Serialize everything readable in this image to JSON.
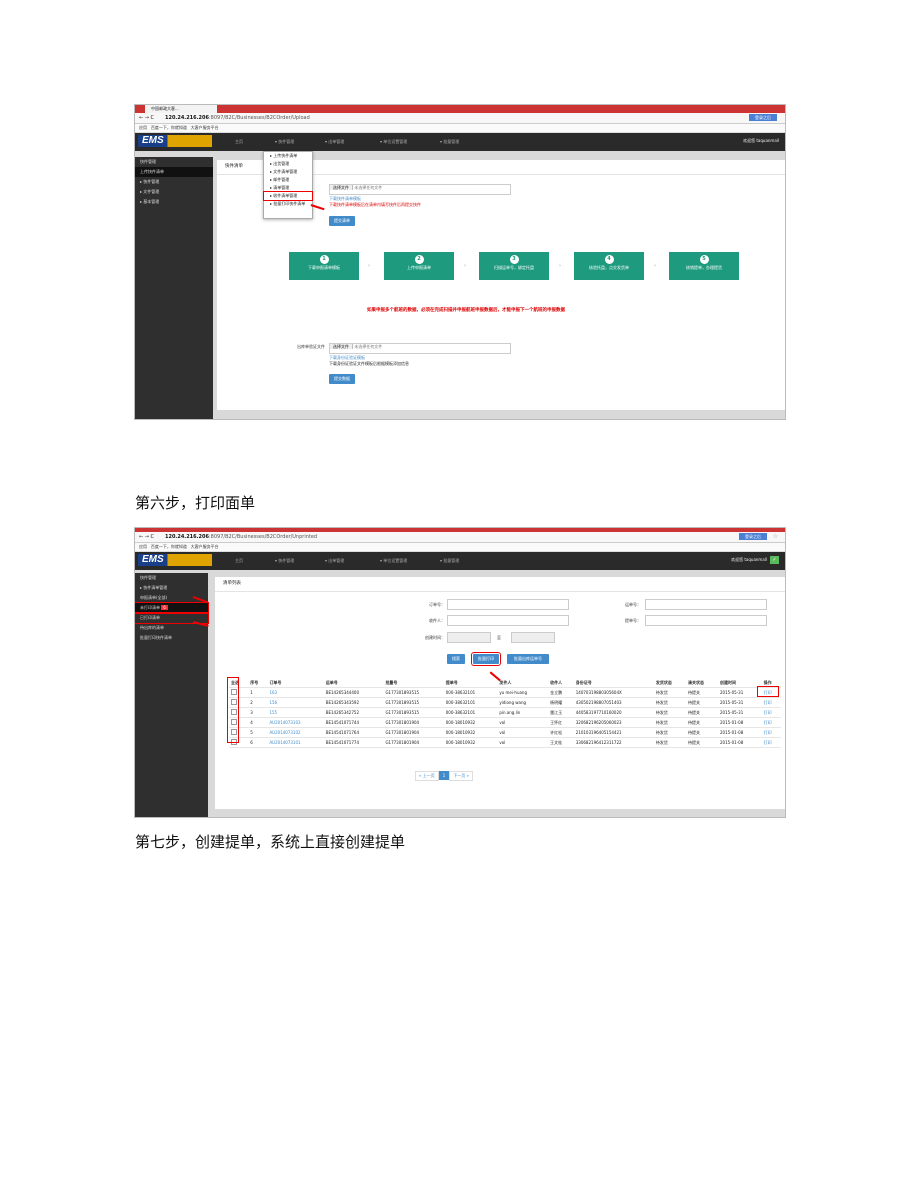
{
  "shot1": {
    "tab_title": "中国邮政大客...",
    "url_host": "120.24.216.206",
    "url_path": ":8097/B2C/Businesses/B2COrder/Upload",
    "bookmarks": [
      "应用",
      "百度一下，你就知道",
      "大客户服务平台"
    ],
    "login_button": "登录之后",
    "logo": "EMS",
    "nav": [
      "主页",
      "▾ 快件管理",
      "▾ 出单管理",
      "▾ 单位设置管理",
      "▾ 批量管理"
    ],
    "user": "欢迎您 taquanmall",
    "sidebar": [
      "快件管理",
      "上传快件清单",
      "▸ 快件管理",
      "▸ 文件管理",
      "▸ 基本管理"
    ],
    "dropdown": [
      "▸ 上传快件清单",
      "▸ 出货管理",
      "▸ 文件清单管理",
      "▸ 邮件管理",
      "▸ 清单管理",
      "▸ 收件清单管理",
      "▸ 批量打印快件清单"
    ],
    "panel_title": "快件清单",
    "choose_file": "选择文件",
    "no_file": "未选择任何文件",
    "template_link": "下载快件清单模板",
    "note1": "下载快件清单模板后在清单内填写快件后再提交快件",
    "submit": "提交清单",
    "steps": [
      {
        "num": "1",
        "label": "下载申报清单模板"
      },
      {
        "num": "2",
        "label": "上传申报清单"
      },
      {
        "num": "3",
        "label": "扫描运单号，绑定托盘"
      },
      {
        "num": "4",
        "label": "核验托盘，点交发货单"
      },
      {
        "num": "5",
        "label": "核销提单，办理提货"
      }
    ],
    "red_note": "如果申报多个航班的数据，必须在完成扫描并申报航班申报数据后，才能申报下一个航班的申报数据",
    "section2_label": "出库单验证文件",
    "section2_link": "下载身份证验证模板",
    "section2_note": "下载身份证验证文件模板后根据模板添加信息",
    "section2_submit": "提交数据"
  },
  "caption1": "第六步，打印面单",
  "shot2": {
    "url_host": "120.24.216.206",
    "url_path": ":8097/B2C/Businesses/B2COrder/Unprinted",
    "bookmarks": [
      "应用",
      "百度一下，你就知道",
      "大客户服务平台"
    ],
    "login_button": "登录之后",
    "logo": "EMS",
    "nav": [
      "主页",
      "▾ 快件管理",
      "▾ 出单管理",
      "▾ 单位设置管理",
      "▾ 批量管理"
    ],
    "user": "欢迎您 taquanmall",
    "sidebar": [
      "快件管理",
      "▸ 快件清单管理",
      "申报清单(全部)",
      "未打印清单",
      "已打印清单",
      "待出库的清单",
      "批量打印快件清单"
    ],
    "unprinted_badge": "6",
    "panel_title": "清单列表",
    "filters": {
      "order_no": "订单号：",
      "waybill_no": "运单号：",
      "recipient": "收件人：",
      "bill_no": "提单号：",
      "created": "创建时间：",
      "to": "至"
    },
    "buttons": [
      "搜索",
      "批量打印",
      "批量出库运单号"
    ],
    "columns": [
      "全选",
      "序号",
      "订单号",
      "运单号",
      "批量号",
      "提单号",
      "发件人",
      "收件人",
      "身份证号",
      "发货状态",
      "清关状态",
      "创建时间",
      "操作"
    ],
    "rows": [
      [
        "1",
        "163",
        "BE14265344400",
        "G177301893515",
        "000-38632101",
        "yu mei-huang",
        "金立鹏",
        "14070319880305604X",
        "待发货",
        "待提关",
        "2015-05-31",
        "打印"
      ],
      [
        "2",
        "156",
        "BE14265343592",
        "G177301893515",
        "000-38632101",
        "yidiong wang",
        "杨明耀",
        "430502198807051403",
        "待发货",
        "待提关",
        "2015-05-31",
        "打印"
      ],
      [
        "3",
        "155",
        "BE14265342752",
        "G177301893515",
        "000-38632101",
        "pin.ang.lin",
        "雷江玉",
        "440583197710160020",
        "待发货",
        "待提关",
        "2015-05-31",
        "打印"
      ],
      [
        "4",
        "AU2014073103",
        "BE14541071744",
        "G177301801904",
        "000-18010932",
        "vol",
        "王怀红",
        "320682196205060023",
        "待发货",
        "待提关",
        "2015-01-08",
        "打印"
      ],
      [
        "5",
        "AU2014073102",
        "BE14541071764",
        "G177301801904",
        "000-18010932",
        "vol",
        "许红松",
        "210103196405154421",
        "待发货",
        "待提关",
        "2015-01-08",
        "打印"
      ],
      [
        "6",
        "AU2014073101",
        "BE14541071774",
        "G177301801904",
        "000-18010932",
        "vol",
        "王文桂",
        "330682196412311722",
        "待发货",
        "待提关",
        "2015-01-08",
        "打印"
      ]
    ],
    "pager": [
      "« 上一页",
      "1",
      "下一页 »"
    ]
  },
  "caption2": "第七步，创建提单，系统上直接创建提单"
}
